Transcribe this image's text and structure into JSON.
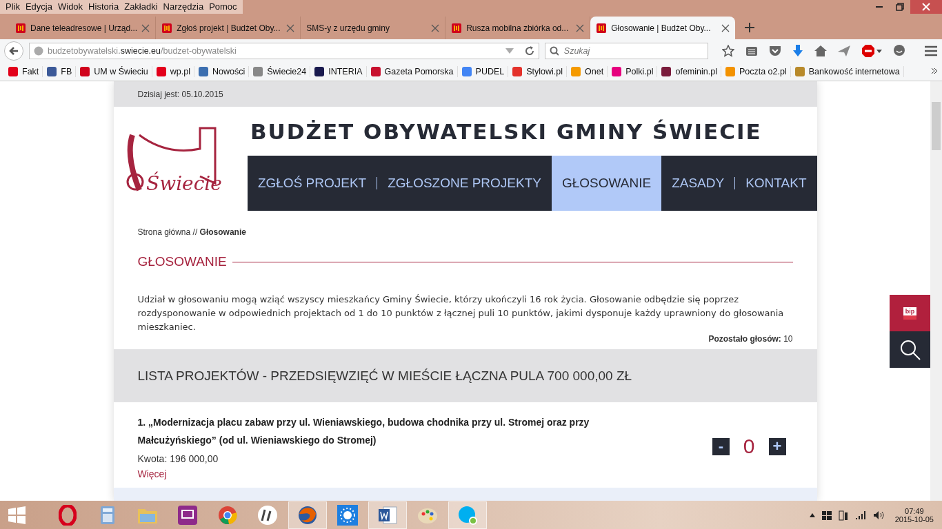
{
  "menu": [
    "Plik",
    "Edycja",
    "Widok",
    "Historia",
    "Zakładki",
    "Narzędzia",
    "Pomoc"
  ],
  "tabs": [
    {
      "title": "Dane teleadresowe | Urząd...",
      "icon": true,
      "selected": false
    },
    {
      "title": "Zgłoś projekt | Budżet Oby...",
      "icon": true,
      "selected": false
    },
    {
      "title": "SMS-y z urzędu gminy",
      "icon": false,
      "selected": false
    },
    {
      "title": "Rusza mobilna zbiórka od...",
      "icon": true,
      "selected": false
    },
    {
      "title": "Głosowanie | Budżet Oby...",
      "icon": true,
      "selected": true
    }
  ],
  "address": {
    "prefix": "budzetobywatelski.",
    "domain": "swiecie.eu",
    "path": "/budzet-obywatelski"
  },
  "search": {
    "placeholder": "Szukaj"
  },
  "bookmarks": [
    "Fakt",
    "FB",
    "UM w Świeciu",
    "wp.pl",
    "Nowości",
    "Świecie24",
    "INTERIA",
    "Gazeta Pomorska",
    "PUDEL",
    "Stylowi.pl",
    "Onet",
    "Polki.pl",
    "ofeminin.pl",
    "Poczta o2.pl",
    "Bankowość internetowa"
  ],
  "page": {
    "date": "Dzisiaj jest: 05.10.2015",
    "logo_text": "Świecie",
    "site_title": "BUDŻET OBYWATELSKI GMINY ŚWIECIE",
    "nav": [
      {
        "label": "ZGŁOŚ PROJEKT",
        "selected": false
      },
      {
        "label": "ZGŁOSZONE PROJEKTY",
        "selected": false
      },
      {
        "label": "GŁOSOWANIE",
        "selected": true
      },
      {
        "label": "ZASADY",
        "selected": false
      },
      {
        "label": "KONTAKT",
        "selected": false
      }
    ],
    "breadcrumb": {
      "home": "Strona główna",
      "separator": "//",
      "current": "Głosowanie"
    },
    "heading": "GŁOSOWANIE",
    "intro": "Udział w głosowaniu mogą wziąć wszyscy mieszkańcy Gminy Świecie, którzy ukończyli 16 rok życia. Głosowanie odbędzie się poprzez rozdysponowanie w odpowiednich projektach od 1 do 10 punktów z łącznej puli 10 punktów, jakimi dysponuje każdy uprawniony do głosowania mieszkaniec.",
    "remaining_label": "Pozostało głosów:",
    "remaining_value": "10",
    "section_title": "LISTA PROJEKTÓW - PRZEDSIĘWZIĘĆ W MIEŚCIE ŁĄCZNA PULA 700 000,00 ZŁ",
    "projects": [
      {
        "title": "1. „Modernizacja placu zabaw przy ul. Wieniawskiego, budowa chodnika przy ul. Stromej oraz przy Małcużyńskiego” (od ul. Wieniawskiego do Stromej)",
        "amount": "Kwota: 196 000,00",
        "more": "Więcej",
        "minus": "-",
        "votes": "0",
        "plus": "+"
      }
    ],
    "side_badge": "bip"
  },
  "taskbar": {
    "apps": [
      {
        "kind": "ring",
        "active": false
      },
      {
        "kind": "calculator",
        "active": false
      },
      {
        "kind": "folder",
        "active": false
      },
      {
        "kind": "screen",
        "active": false
      },
      {
        "kind": "wheel",
        "active": false
      },
      {
        "kind": "logo",
        "active": false
      },
      {
        "kind": "globe",
        "active": true
      },
      {
        "kind": "sun",
        "active": false
      },
      {
        "kind": "document",
        "active": true
      },
      {
        "kind": "palette",
        "active": false
      },
      {
        "kind": "chat",
        "active": true
      }
    ],
    "time": "07:49",
    "date": "2015-10-05"
  }
}
